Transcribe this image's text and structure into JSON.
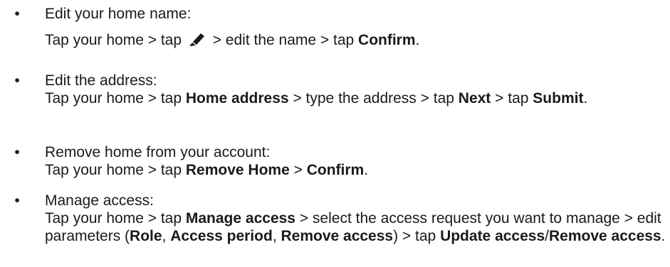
{
  "items": [
    {
      "heading": "Edit your home name:",
      "steps": [
        {
          "t": "Tap your home > tap "
        },
        {
          "icon": "pencil-icon"
        },
        {
          "t": " > edit the name > tap "
        },
        {
          "b": "Confirm"
        },
        {
          "t": "."
        }
      ]
    },
    {
      "heading": "Edit the address:",
      "steps": [
        {
          "t": "Tap your home > tap "
        },
        {
          "b": "Home address"
        },
        {
          "t": " > type the address > tap "
        },
        {
          "b": "Next"
        },
        {
          "t": " > tap "
        },
        {
          "b": "Submit"
        },
        {
          "t": "."
        }
      ]
    },
    {
      "heading": "Remove home from your account:",
      "steps": [
        {
          "t": "Tap your home > tap "
        },
        {
          "b": "Remove Home"
        },
        {
          "t": " > "
        },
        {
          "b": "Confirm"
        },
        {
          "t": "."
        }
      ]
    },
    {
      "heading": "Manage access:",
      "steps": [
        {
          "t": "Tap your home > tap "
        },
        {
          "b": "Manage access"
        },
        {
          "t": " > select the access request you want to manage > edit parameters ("
        },
        {
          "b": "Role"
        },
        {
          "t": ", "
        },
        {
          "b": "Access period"
        },
        {
          "t": ", "
        },
        {
          "b": "Remove access"
        },
        {
          "t": ") > tap "
        },
        {
          "b": "Update access"
        },
        {
          "t": "/"
        },
        {
          "b": "Remove access"
        },
        {
          "t": "."
        }
      ]
    }
  ],
  "bullet_char": "•"
}
